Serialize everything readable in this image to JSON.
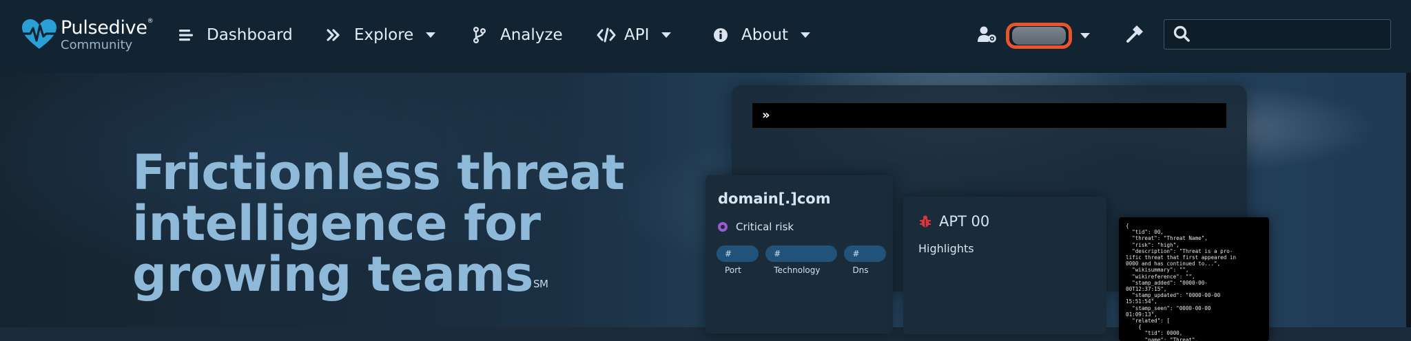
{
  "brand": {
    "name": "Pulsedive",
    "trademark": "®",
    "sub": "Community"
  },
  "nav": [
    {
      "label": "Dashboard",
      "icon": "list-icon",
      "dropdown": false
    },
    {
      "label": "Explore",
      "icon": "double-chevron-right-icon",
      "dropdown": true
    },
    {
      "label": "Analyze",
      "icon": "branch-icon",
      "dropdown": false
    },
    {
      "label": "API",
      "icon": "code-icon",
      "dropdown": true
    },
    {
      "label": "About",
      "icon": "info-circle-icon",
      "dropdown": true
    }
  ],
  "user": {
    "icon": "user-gear-icon"
  },
  "tools": {
    "icon": "hammer-icon"
  },
  "search": {
    "placeholder": "",
    "value": ""
  },
  "colors": {
    "accent": "#2a9fd6",
    "highlight": "#e8542b",
    "title": "#8fb9d8"
  },
  "hero": {
    "title": "Frictionless threat intelligence for growing teams",
    "mark": "SM"
  },
  "mockup": {
    "console_prompt": "»",
    "domain_card": {
      "title": "domain[.]com",
      "risk": "Critical risk",
      "tags": [
        "# Port",
        "# Technology",
        "# Dns"
      ]
    },
    "threat_card": {
      "title": "APT 00",
      "subtitle": "Highlights"
    },
    "json_lines": "{\n  \"tid\": 00,\n  \"threat\": \"Threat Name\",\n  \"risk\": \"high\",\n  \"description\": \"Threat is a pro-\nlific threat that first appeared in\n0000 and has continued to...\",\n  \"wikisummary\": \"\",\n  \"wikireference\": \"\",\n  \"stamp_added\": \"0000-00-\n00T12:37:15\",\n  \"stamp_updated\": \"0000-00-00\n15:51:54\",\n  \"stamp_seen\": \"0000-00-00\n01:09:13\",\n  \"related\": [\n    {\n      \"tid\": 0000,\n      \"name\": \"Threat\","
  }
}
